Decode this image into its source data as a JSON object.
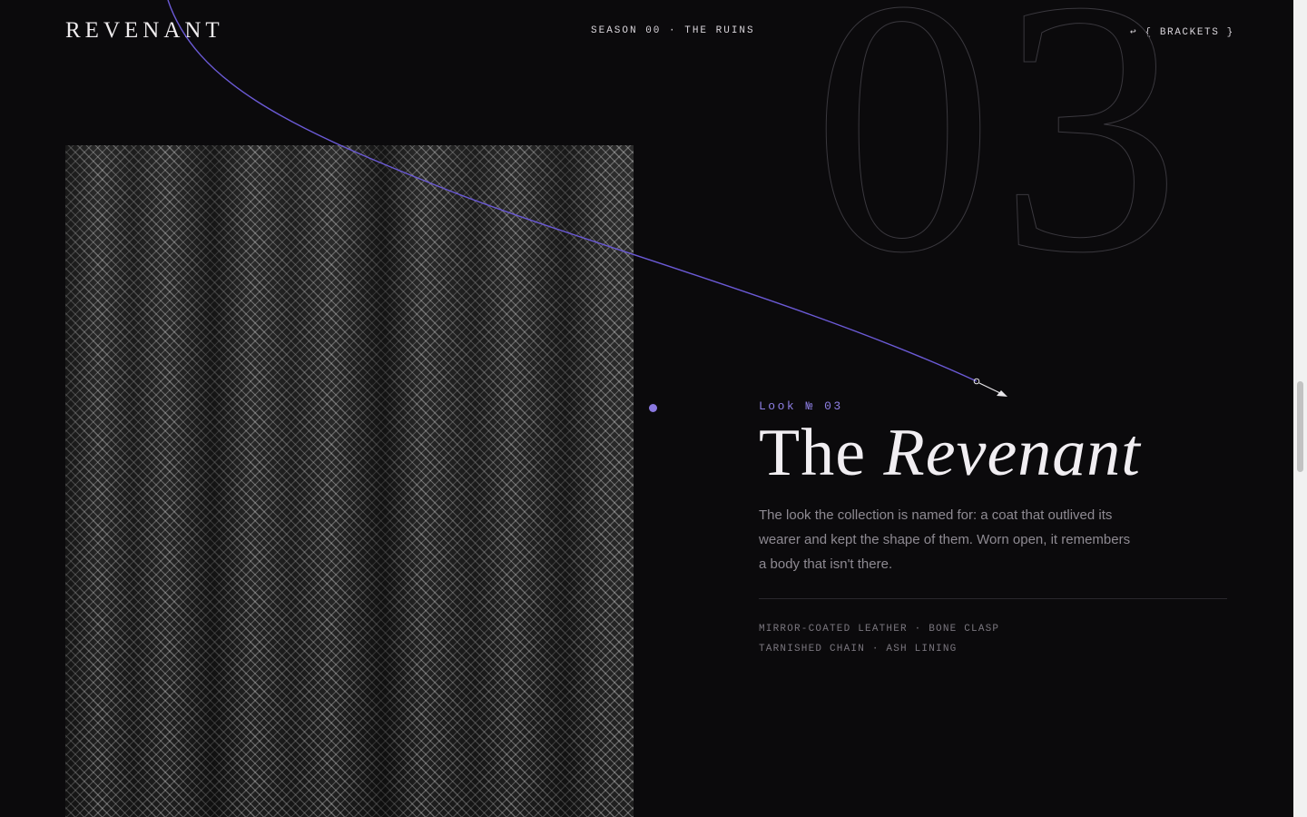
{
  "header": {
    "logo": "REVENANT",
    "season": "SEASON 00 · THE RUINS",
    "back_link": "↩ { BRACKETS }"
  },
  "hero": {
    "number": "03"
  },
  "look": {
    "label": "Look № 03",
    "title_plain": "The",
    "title_italic": "Revenant",
    "description": "The look the collection is named for: a coat that outlived its wearer and kept the shape of them. Worn open, it remembers a body that isn't there.",
    "materials": [
      "MIRROR-COATED LEATHER · BONE CLASP",
      "TARNISHED CHAIN · ASH LINING"
    ]
  },
  "colors": {
    "background": "#0b0a0c",
    "accent": "#8e7fe4",
    "curve": "#6b5ad6"
  }
}
